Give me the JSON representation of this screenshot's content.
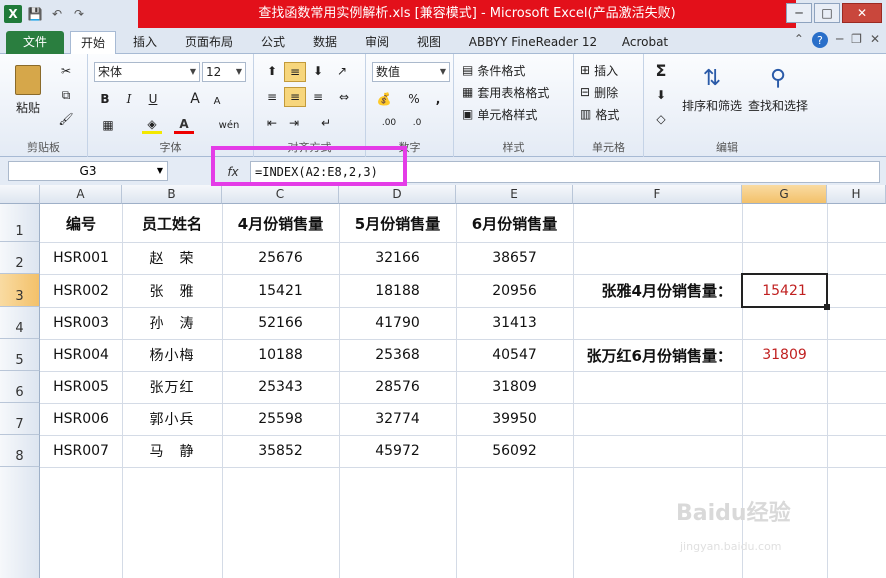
{
  "titlebar": {
    "title": "查找函数常用实例解析.xls  [兼容模式] - Microsoft Excel(产品激活失败)",
    "qat": {
      "logo": "X",
      "save": "💾",
      "undo": "↶",
      "redo": "↷"
    },
    "win": {
      "min": "─",
      "max": "□",
      "close": "✕"
    },
    "accent_color": "#e3101a"
  },
  "tabs": {
    "file": "文件",
    "items": [
      "开始",
      "插入",
      "页面布局",
      "公式",
      "数据",
      "审阅",
      "视图",
      "ABBYY FineReader 12",
      "Acrobat"
    ],
    "active": "开始",
    "right_icons": {
      "collapse": "⌃",
      "help": "?",
      "min": "─",
      "restore": "❐",
      "close": "✕"
    }
  },
  "ribbon": {
    "clipboard": {
      "label": "剪贴板",
      "paste": "粘贴"
    },
    "font": {
      "label": "字体",
      "font_name": "宋体",
      "font_size": "12",
      "bold": "B",
      "italic": "I",
      "underline": "U",
      "grow": "A",
      "shrink": "A",
      "phonetic": "wén"
    },
    "align": {
      "label": "对齐方式"
    },
    "number": {
      "label": "数字",
      "format": "数值",
      "percent": "%",
      "comma": ","
    },
    "styles": {
      "label": "样式",
      "conditional": "条件格式",
      "table": "套用表格格式",
      "cell": "单元格样式"
    },
    "cells": {
      "label": "单元格",
      "insert": "插入",
      "delete": "删除",
      "format": "格式"
    },
    "editing": {
      "label": "编辑",
      "sort": "排序和筛选",
      "find": "查找和选择",
      "sum": "Σ"
    }
  },
  "formula_bar": {
    "name_box": "G3",
    "fx": "fx",
    "formula": "=INDEX(A2:E8,2,3)",
    "highlight_color": "#e43ce7"
  },
  "sheet": {
    "columns": [
      "A",
      "B",
      "C",
      "D",
      "E",
      "F",
      "G",
      "H"
    ],
    "selected_column": "G",
    "selected_row": "3",
    "rows": [
      "1",
      "2",
      "3",
      "4",
      "5",
      "6",
      "7",
      "8"
    ],
    "headers": [
      "编号",
      "员工姓名",
      "4月份销售量",
      "5月份销售量",
      "6月份销售量"
    ],
    "data": [
      [
        "HSR001",
        "赵　荣",
        "25676",
        "32166",
        "38657"
      ],
      [
        "HSR002",
        "张　雅",
        "15421",
        "18188",
        "20956"
      ],
      [
        "HSR003",
        "孙　涛",
        "52166",
        "41790",
        "31413"
      ],
      [
        "HSR004",
        "杨小梅",
        "10188",
        "25368",
        "40547"
      ],
      [
        "HSR005",
        "张万红",
        "25343",
        "28576",
        "31809"
      ],
      [
        "HSR006",
        "郭小兵",
        "25598",
        "32774",
        "39950"
      ],
      [
        "HSR007",
        "马　静",
        "35852",
        "45972",
        "56092"
      ]
    ],
    "label_f3": "张雅4月份销售量：",
    "value_g3": "15421",
    "label_f5": "张万红6月份销售量：",
    "value_g5": "31809",
    "result_color": "#c02020"
  },
  "watermark": {
    "brand": "Baidu经验",
    "url": "jingyan.baidu.com"
  }
}
